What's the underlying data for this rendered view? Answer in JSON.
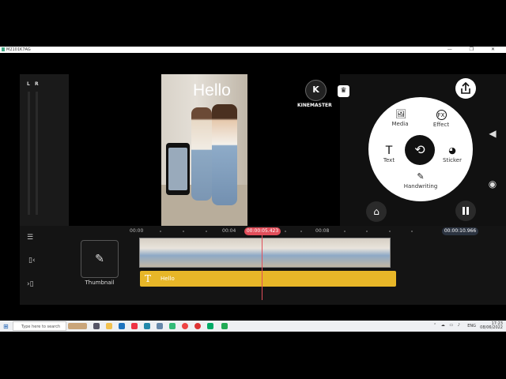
{
  "window": {
    "title": "M2101K7AG",
    "controls": "— ❐ ✕"
  },
  "audio": {
    "left_label": "L",
    "right_label": "R"
  },
  "preview": {
    "overlay_text": "Hello"
  },
  "brand": {
    "logo_letter": "K",
    "name": "KINEMASTER"
  },
  "wheel": {
    "media": "Media",
    "effect": "Effect",
    "text": "Text",
    "sticker": "Sticker",
    "handwriting": "Handwriting",
    "effect_glyph": "FX"
  },
  "timeline": {
    "thumbnail_label": "Thumbnail",
    "ruler": [
      "00:00",
      "00:04",
      "00:08"
    ],
    "current_time": "00:00:05.423",
    "end_time": "00:00:10.966",
    "text_clip_label": "Hello",
    "text_clip_icon": "T"
  },
  "taskbar": {
    "search_placeholder": "Type here to search",
    "time": "17:23",
    "date": "08/06/2022",
    "lang": "ENG"
  }
}
